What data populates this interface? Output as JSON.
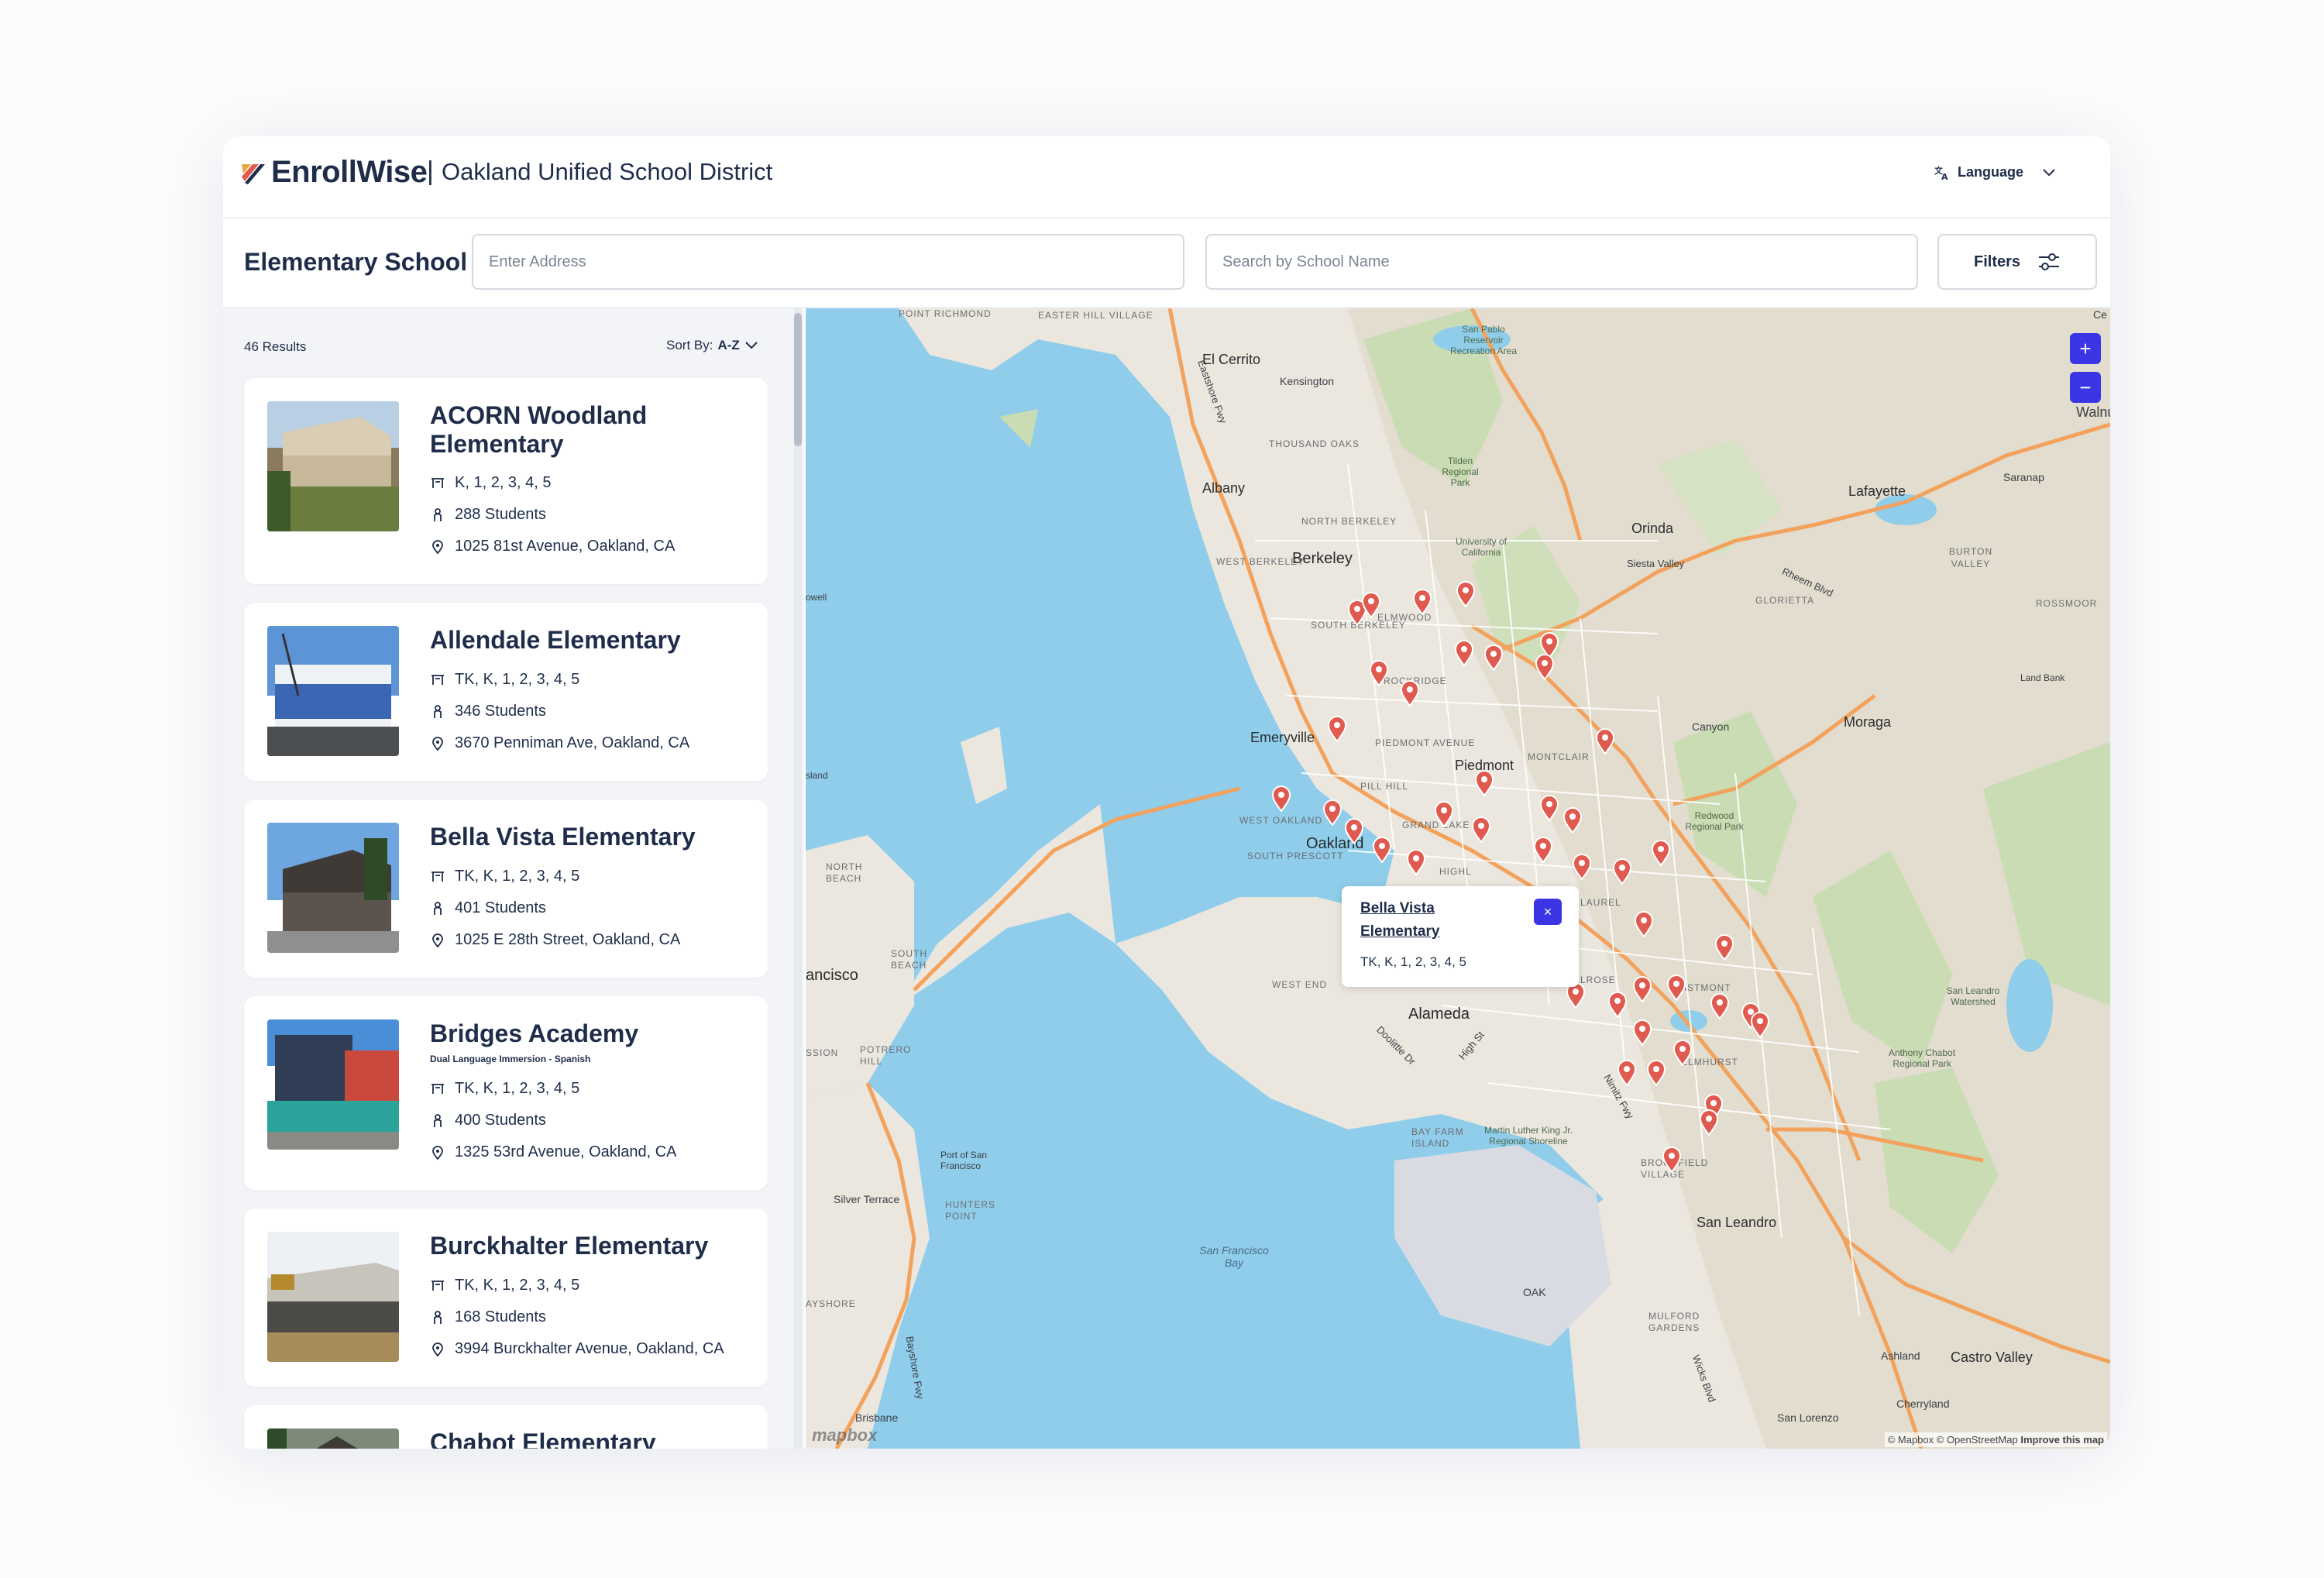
{
  "header": {
    "brand": "EnrollWise",
    "separator": "|",
    "district": "Oakland Unified School District",
    "language_label": "Language"
  },
  "search": {
    "title": "Elementary School",
    "address_placeholder": "Enter Address",
    "name_placeholder": "Search by School Name",
    "filters_label": "Filters"
  },
  "list": {
    "results": "46 Results",
    "sort_prefix": "Sort By:",
    "sort_value": "A-Z",
    "schools": [
      {
        "name": "ACORN Woodland Elementary",
        "subtitle": "",
        "grades": "K, 1, 2, 3, 4, 5",
        "students": "288 Students",
        "address": "1025 81st Avenue, Oakland, CA"
      },
      {
        "name": "Allendale Elementary",
        "subtitle": "",
        "grades": "TK, K, 1, 2, 3, 4, 5",
        "students": "346 Students",
        "address": "3670 Penniman Ave, Oakland, CA"
      },
      {
        "name": "Bella Vista Elementary",
        "subtitle": "",
        "grades": "TK, K, 1, 2, 3, 4, 5",
        "students": "401 Students",
        "address": "1025 E 28th Street, Oakland, CA"
      },
      {
        "name": "Bridges Academy",
        "subtitle": "Dual Language Immersion - Spanish",
        "grades": "TK, K, 1, 2, 3, 4, 5",
        "students": "400 Students",
        "address": "1325 53rd Avenue, Oakland, CA"
      },
      {
        "name": "Burckhalter Elementary",
        "subtitle": "",
        "grades": "TK, K, 1, 2, 3, 4, 5",
        "students": "168 Students",
        "address": "3994 Burckhalter Avenue, Oakland, CA"
      },
      {
        "name": "Chabot Elementary",
        "subtitle": "",
        "grades": "",
        "students": "",
        "address": ""
      }
    ]
  },
  "map": {
    "zoom_in": "+",
    "zoom_out": "−",
    "popup": {
      "name": "Bella Vista Elementary",
      "grades": "TK, K, 1, 2, 3, 4, 5",
      "close": "×"
    },
    "attribution_prefix": "© Mapbox © OpenStreetMap",
    "attribution_link": "Improve this map",
    "logo": "mapbox",
    "colors": {
      "pin": "#e05a4f",
      "accent": "#3b35e6",
      "water": "#8fcdeb",
      "park": "#c9dcb3",
      "land": "#ebe7df"
    },
    "labels": {
      "el_cerrito": "El Cerrito",
      "kensington": "Kensington",
      "albany": "Albany",
      "thousand_oaks": "THOUSAND OAKS",
      "north_berkeley": "NORTH BERKELEY",
      "berkeley": "Berkeley",
      "west_berkeley": "WEST BERKELEY",
      "south_berkeley": "SOUTH BERKELEY",
      "elmwood": "ELMWOOD",
      "rockridge": "ROCKRIDGE",
      "emeryville": "Emeryville",
      "piedmont_ave": "PIEDMONT AVENUE",
      "piedmont": "Piedmont",
      "montclair": "MONTCLAIR",
      "oakland": "Oakland",
      "west_oakland": "WEST OAKLAND",
      "south_prescott": "SOUTH PRESCOTT",
      "grand_lake": "GRAND LAKE",
      "laurel": "LAUREL",
      "alameda": "Alameda",
      "west_end": "WEST END",
      "melrose": "MELROSE",
      "eastmont": "EASTMONT",
      "elmhurst": "ELMHURST",
      "brookfield": "BROOKFIELD VILLAGE",
      "san_leandro": "San Leandro",
      "castro_valley": "Castro Valley",
      "ashland": "Ashland",
      "cherryland": "Cherryland",
      "san_lorenzo": "San Lorenzo",
      "orinda": "Orinda",
      "lafayette": "Lafayette",
      "moraga": "Moraga",
      "canyon": "Canyon",
      "saranap": "Saranap",
      "burton_valley": "BURTON VALLEY",
      "glorietta": "GLORIETTA",
      "rossmoor": "ROSSMOOR",
      "land_bank": "Land Bank",
      "siesta_valley": "Siesta Valley",
      "university": "University of California",
      "tilden": "Tilden Regional Park",
      "san_pablo": "San Pablo Reservoir Recreation Area",
      "redwood": "Redwood Regional Park",
      "anthony_chabot": "Anthony Chabot Regional Park",
      "san_leandro_ws": "San Leandro Watershed",
      "bay_farm": "BAY FARM ISLAND",
      "mlk_shore": "Martin Luther King Jr. Regional Shoreline",
      "oak": "OAK",
      "sf": "ancisco",
      "sf_bay": "San Francisco Bay",
      "north_beach": "NORTH BEACH",
      "south_beach": "SOUTH BEACH",
      "potrero_hill": "POTRERO HILL",
      "hunters_point": "HUNTERS POINT",
      "port_sf": "Port of San Francisco",
      "silver_terrace": "Silver Terrace",
      "mulford": "MULFORD GARDENS",
      "brisbane": "Brisbane",
      "easter_hill": "EASTER HILL VILLAGE",
      "point_richmond": "POINT RICHMOND",
      "walnut_creek": "Walnut Cree",
      "ce": "Ce",
      "owell": "owell",
      "sland": "sland",
      "mission": "SSION",
      "rheem": "Rheem Blvd",
      "high_st": "High St",
      "doolittle": "Doolittle Dr",
      "wicks": "Wicks Blvd",
      "eastshore": "Eastshore Fwy",
      "bayshore": "Bayshore Fwy",
      "nimitz": "Nimitz Fwy",
      "ayshore": "AYSHORE",
      "pill_hill": "PILL HILL",
      "highland": "HIGHL"
    }
  }
}
